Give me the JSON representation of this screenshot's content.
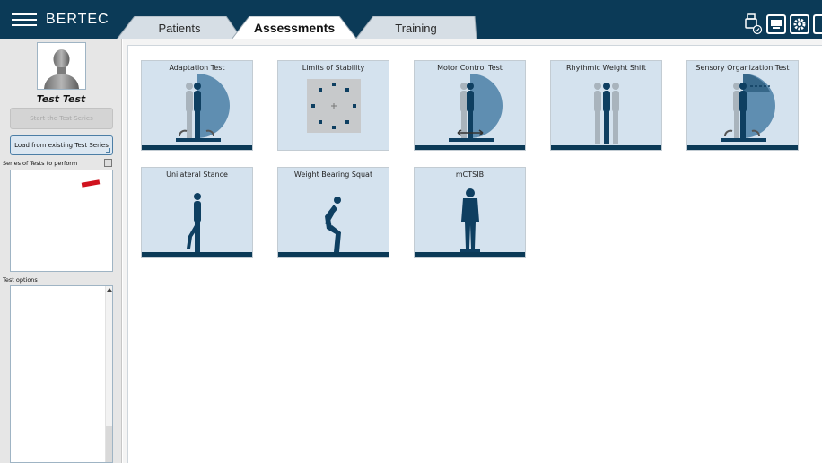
{
  "app": {
    "brand": "BERTEC"
  },
  "tabs": [
    {
      "label": "Patients",
      "active": false
    },
    {
      "label": "Assessments",
      "active": true
    },
    {
      "label": "Training",
      "active": false
    }
  ],
  "top_icons": [
    "usb-icon",
    "monitor-icon",
    "settings-icon"
  ],
  "sidebar": {
    "patient_name": "Test Test",
    "start_button": "Start the Test Series",
    "load_button": "Load from existing Test Series",
    "series_label": "Series of Tests to perform",
    "options_label": "Test options"
  },
  "assessments": [
    {
      "title": "Adaptation Test",
      "figure": "adaptation"
    },
    {
      "title": "Limits of Stability",
      "figure": "stability"
    },
    {
      "title": "Motor Control Test",
      "figure": "motor"
    },
    {
      "title": "Rhythmic Weight Shift",
      "figure": "rhythmic"
    },
    {
      "title": "Sensory Organization Test",
      "figure": "sensory"
    },
    {
      "title": "Unilateral Stance",
      "figure": "unilateral"
    },
    {
      "title": "Weight Bearing Squat",
      "figure": "squat"
    },
    {
      "title": "mCTSIB",
      "figure": "mctsib"
    }
  ],
  "colors": {
    "topbar": "#0b3a57",
    "card_bg": "#d4e2ee",
    "figure": "#0e3f61",
    "accent": "#4a7fa6",
    "marker": "#d0121e"
  }
}
